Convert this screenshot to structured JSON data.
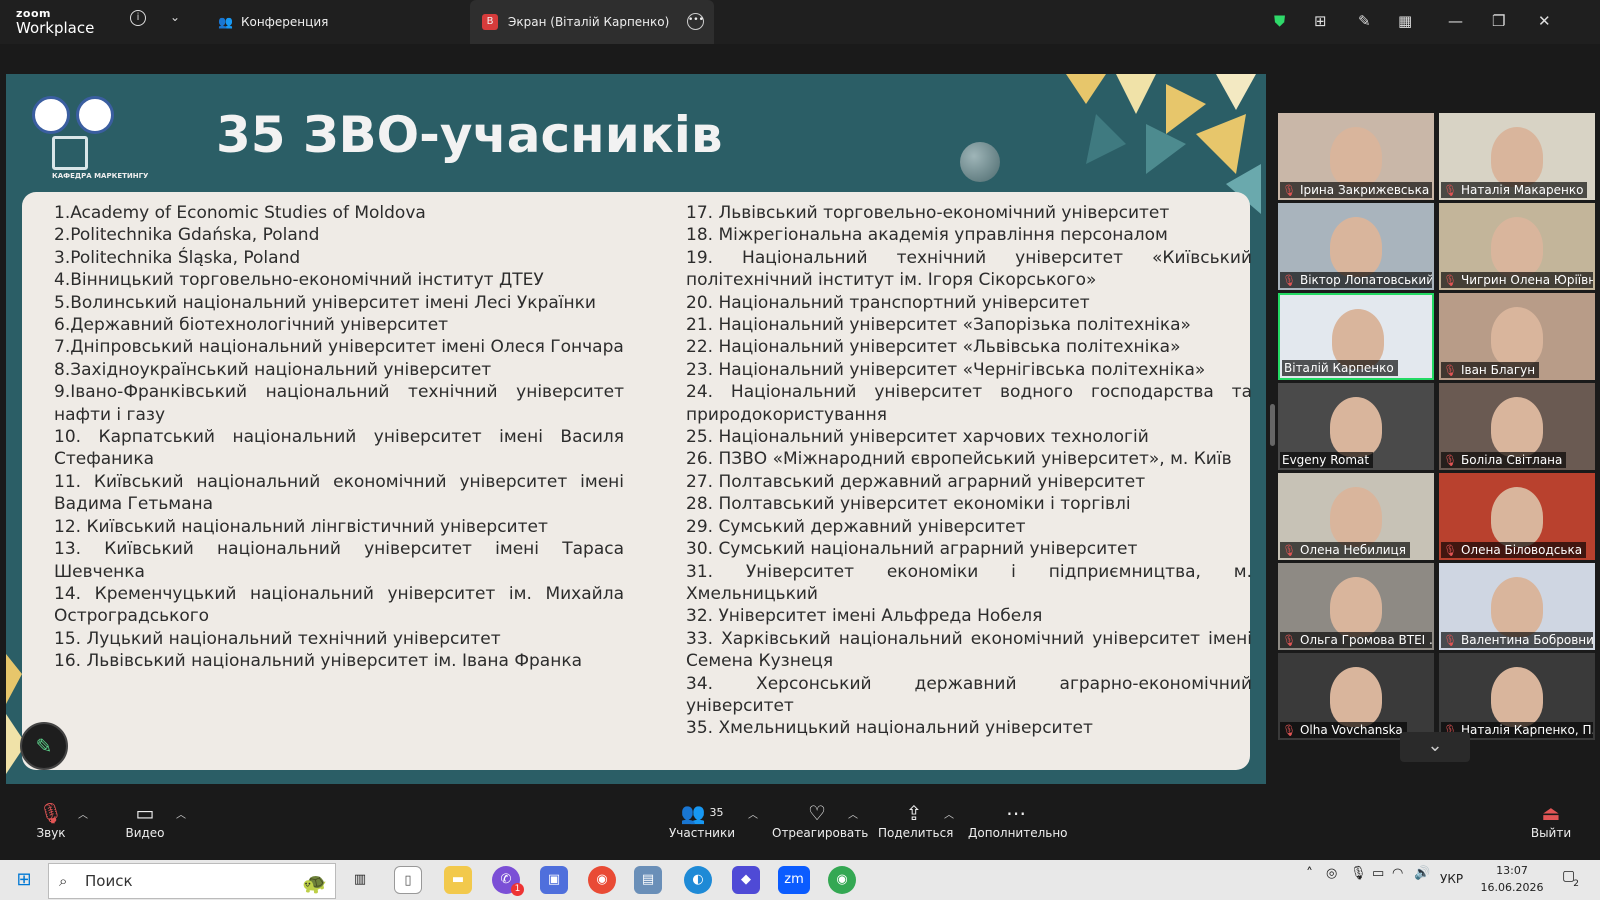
{
  "app": {
    "logo_top": "zoom",
    "logo_bottom": "Workplace"
  },
  "tabs": [
    {
      "label": "Конференция"
    },
    {
      "label": "Экран (Віталій Карпенко)",
      "badge": "В"
    }
  ],
  "slide": {
    "title": "35 ЗВО-учасників",
    "dept_logo_text": "КАФЕДРА МАРКЕТИНГУ",
    "column1": [
      "1.Academy of Economic Studies of Moldova",
      "2.Politechnika Gdańska, Poland",
      "3.Politechnika Śląska, Poland",
      "4.Вінницький торговельно-економічний інститут ДТЕУ",
      "5.Волинський національний університет імені Лесі Українки",
      "6.Державний біотехнологічний університет",
      "7.Дніпровський національний університет імені Олеся Гончара",
      "8.Західноукраїнський національний університет",
      "9.Івано-Франківський національний технічний університет нафти і газу",
      "10. Карпатський національний університет імені Василя Стефаника",
      "11. Київський національний економічний університет імені Вадима Гетьмана",
      "12. Київський національний лінгвістичний університет",
      "13. Київський національний університет імені Тараса Шевченка",
      "14. Кременчуцький національний університет ім. Михайла Остроградського",
      "15. Луцький національний технічний університет",
      "16. Львівський національний університет ім. Івана Франка"
    ],
    "column2": [
      "17. Львівський торговельно-економічний університет",
      "18. Міжрегіональна академія управління персоналом",
      "19. Національний технічний університет «Київський політехнічний інститут ім. Ігоря Сікорського»",
      "20. Національний транспортний університет",
      "21. Національний університет «Запорізька політехніка»",
      "22. Національний університет «Львівська політехніка»",
      "23. Національний університет «Чернігівська політехніка»",
      "24. Національний університет водного господарства та природокористування",
      "25. Національний університет харчових технологій",
      "26. ПЗВО «Міжнародний європейський університет», м. Київ",
      "27. Полтавський державний аграрний університет",
      "28. Полтавський університет економіки і торгівлі",
      "29. Сумський державний університет",
      "30. Сумський національний аграрний університет",
      "31. Університет економіки і підприємництва, м. Хмельницький",
      "32. Університет імені Альфреда Нобеля",
      "33. Харківський національний економічний університет імені Семена Кузнеця",
      "34. Херсонський державний аграрно-економічний університет",
      "35. Хмельницький національний університет"
    ]
  },
  "participants": [
    {
      "name": "Ірина Закрижевська",
      "muted": true
    },
    {
      "name": "Наталія Макаренко",
      "muted": true
    },
    {
      "name": "Віктор Лопатовський",
      "muted": true
    },
    {
      "name": "Чигрин Олена Юріївна",
      "muted": true
    },
    {
      "name": "Віталій Карпенко",
      "muted": false,
      "active": true
    },
    {
      "name": "Іван Благун",
      "muted": true
    },
    {
      "name": "Evgeny Romat",
      "muted": false
    },
    {
      "name": "Боліла Світлана",
      "muted": true
    },
    {
      "name": "Олена Небилиця",
      "muted": true
    },
    {
      "name": "Олена Біловодська",
      "muted": true
    },
    {
      "name": "Ольга Громова ВТЕІ ...",
      "muted": true
    },
    {
      "name": "Валентина Бобровник",
      "muted": true
    },
    {
      "name": "Olha Vovchanska",
      "muted": true
    },
    {
      "name": "Наталія Карпенко, П...",
      "muted": true
    }
  ],
  "toolbar": {
    "audio": "Звук",
    "video": "Видео",
    "participants": "Участники",
    "participants_count": "35",
    "react": "Отреагировать",
    "share": "Поделиться",
    "more": "Дополнительно",
    "leave": "Выйти"
  },
  "taskbar": {
    "search_placeholder": "Поиск",
    "lang": "УКР",
    "time": "13:07",
    "date": "16.06.2026",
    "notif_count": "2",
    "viber_badge": "1"
  },
  "colors": {
    "slide_bg": "#2b5e66",
    "content_bg": "#efebe6",
    "active_border": "#23d963",
    "accent_gold": "#e7c66b"
  }
}
